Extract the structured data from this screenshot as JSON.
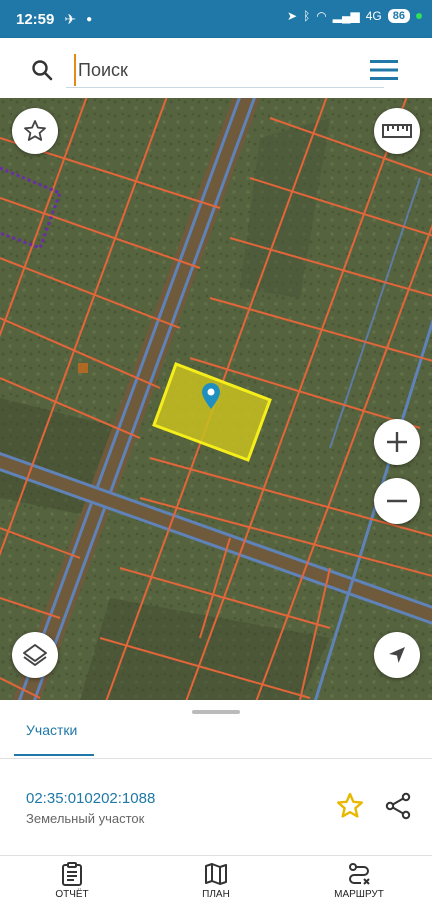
{
  "status_bar": {
    "time": "12:59",
    "network": "4G",
    "battery": "86"
  },
  "search": {
    "placeholder": "Поиск"
  },
  "sheet": {
    "tab": "Участки",
    "parcel_id": "02:35:010202:1088",
    "parcel_type": "Земельный участок"
  },
  "bottom_nav": [
    {
      "label": "ОТЧЁТ",
      "icon": "clipboard-icon"
    },
    {
      "label": "ПЛАН",
      "icon": "map-icon"
    },
    {
      "label": "МАРШРУТ",
      "icon": "route-icon"
    }
  ],
  "colors": {
    "accent": "#1f78a8",
    "parcel_fill": "#c8c020",
    "parcel_border": "#f5ee1a",
    "boundary": "#e2663a",
    "road": "#5f83b8",
    "favorite": "#e8b800"
  }
}
